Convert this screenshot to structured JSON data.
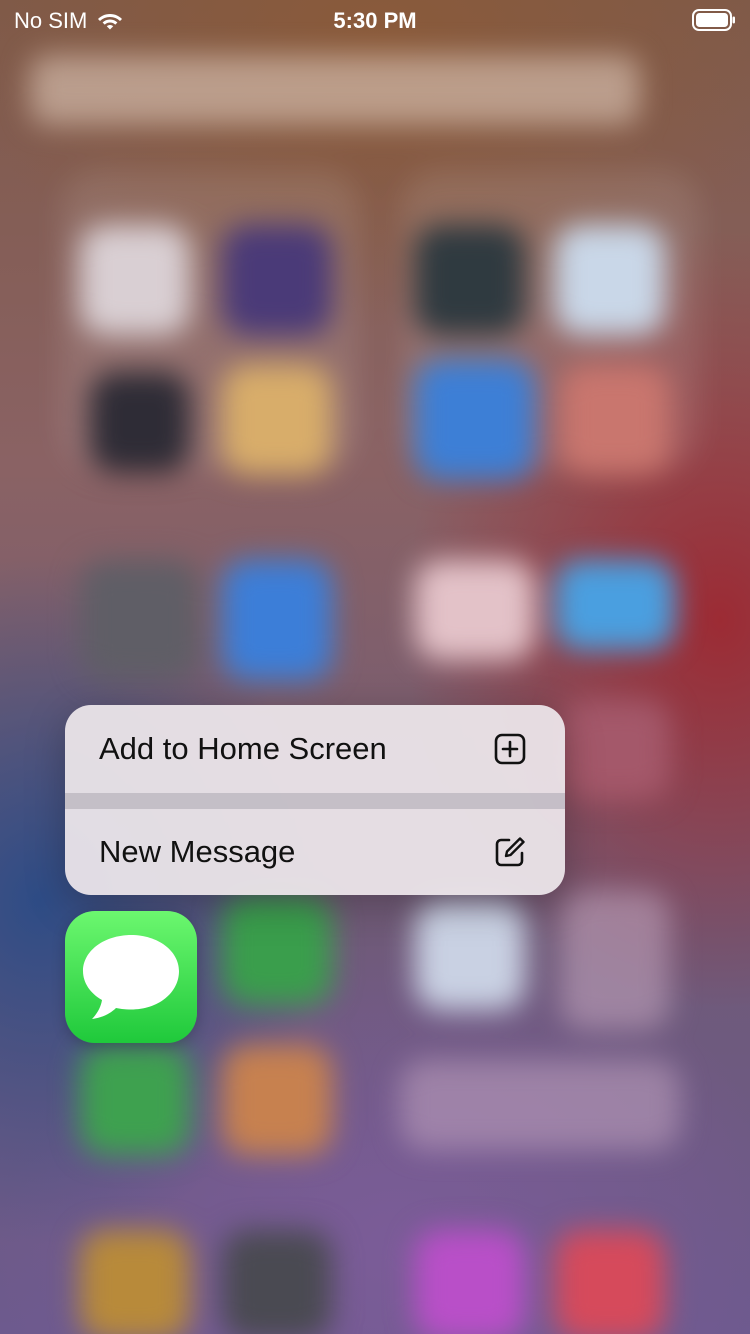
{
  "status_bar": {
    "carrier": "No SIM",
    "time": "5:30 PM",
    "icons": [
      "wifi-icon",
      "battery-icon"
    ]
  },
  "context_menu": {
    "items": [
      {
        "label": "Add to Home Screen",
        "icon": "plus-square-icon"
      },
      {
        "label": "New Message",
        "icon": "compose-icon"
      }
    ]
  },
  "app_icon": {
    "icon": "speech-bubble-icon",
    "color": "#34c759"
  }
}
